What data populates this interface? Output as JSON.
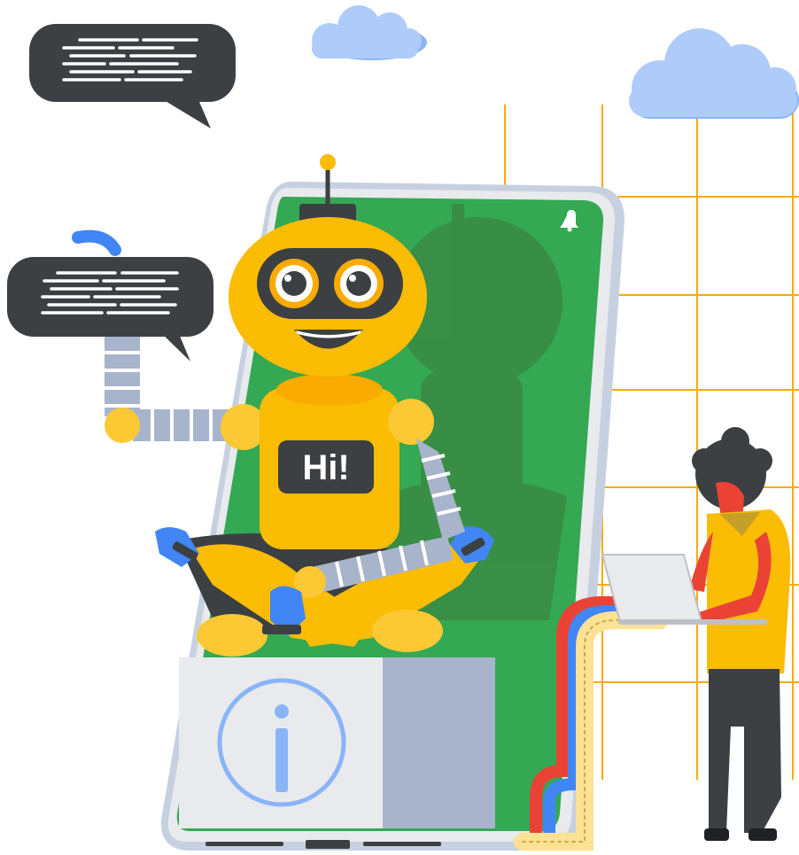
{
  "illustration": {
    "robot_sign_text": "Hi!",
    "colors": {
      "phone_screen": "#34a853",
      "robot_yellow": "#fbbc04",
      "dark_gray": "#3c4043",
      "accent_blue": "#4285f4",
      "accent_red": "#ea4335",
      "cloud_blue": "#aecbfa",
      "grid_yellow": "#f9ab00"
    }
  }
}
